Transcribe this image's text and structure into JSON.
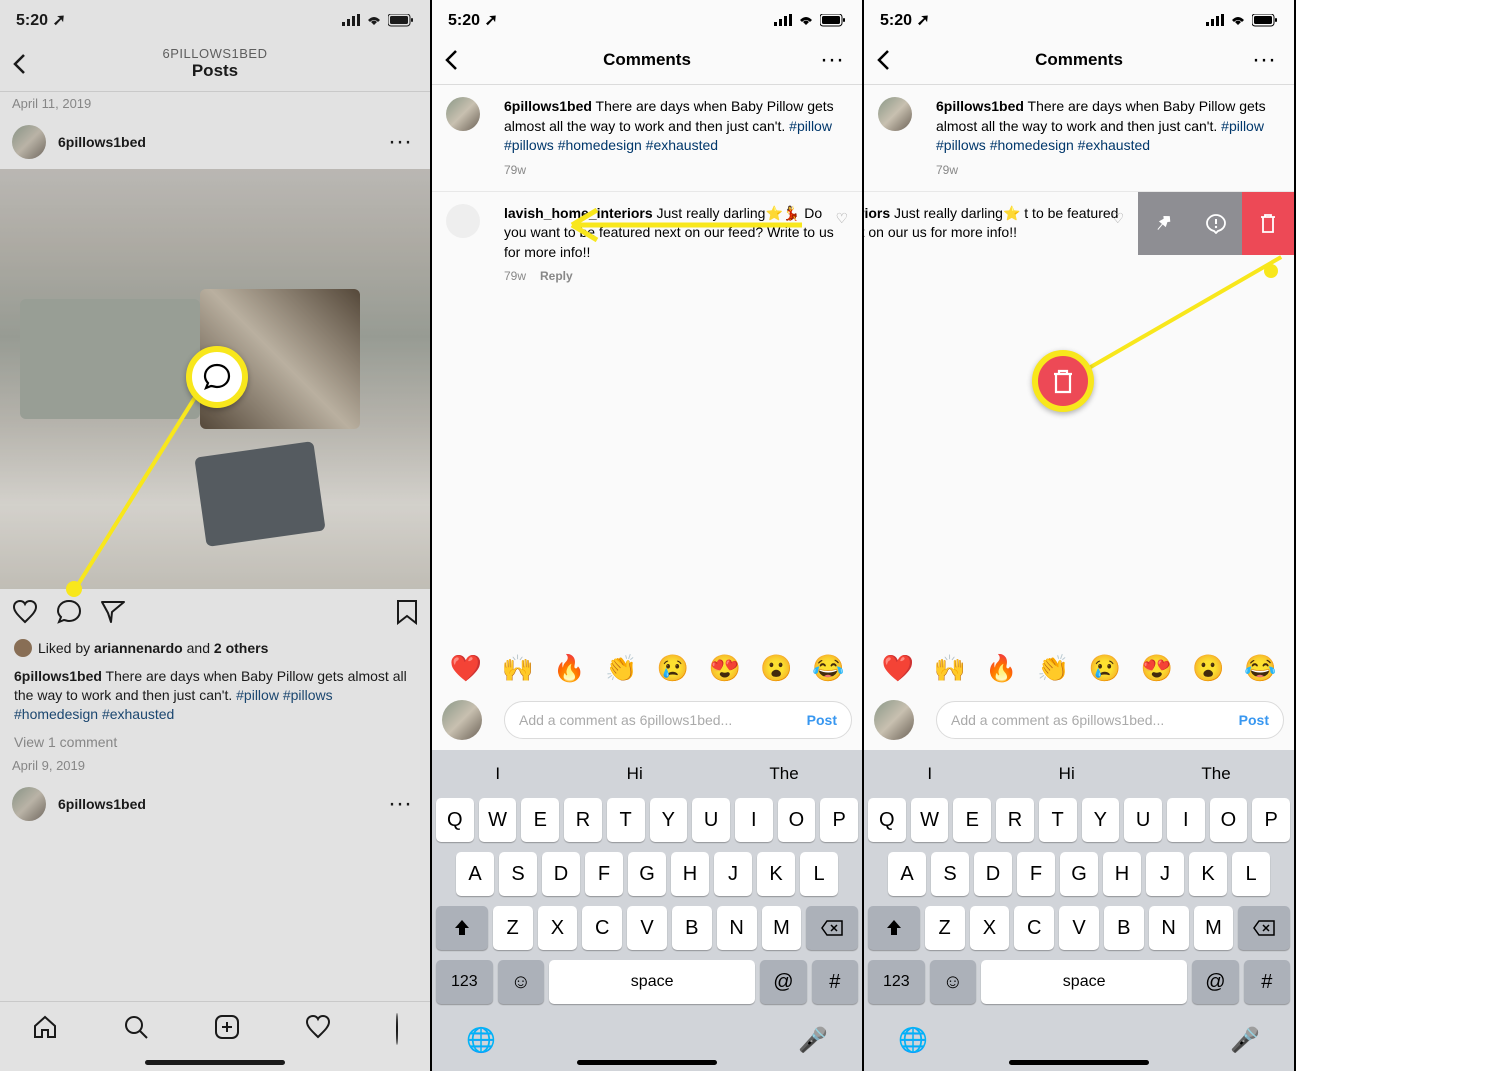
{
  "status": {
    "time": "5:20",
    "arrow": "➚"
  },
  "screen1": {
    "header_sub": "6PILLOWS1BED",
    "header_title": "Posts",
    "date_top": "April 11, 2019",
    "username": "6pillows1bed",
    "likes_prefix": "Liked by ",
    "likes_user": "ariannenardo",
    "likes_mid": " and ",
    "likes_others": "2 others",
    "caption_user": "6pillows1bed",
    "caption_text": " There are days when Baby Pillow gets almost all the way to work and then just can't. ",
    "hashtags": "#pillow #pillows #homedesign #exhausted",
    "view_comments": "View 1 comment",
    "date_bottom": "April 9, 2019"
  },
  "comments_header": "Comments",
  "comments": {
    "author": "6pillows1bed",
    "caption": " There are days when Baby Pillow gets almost all the way to work and then just can't. ",
    "hashtags_1": "#pillow",
    "hashtags_2": "#pillows",
    "hashtags_3": "#homedesign",
    "hashtags_4": "#exhausted",
    "age": "79w",
    "comment1_user": "lavish_home_interiors",
    "comment1_text": " Just really darling⭐💃 Do you want to be featured next on our feed? Write to us for more info!!",
    "comment1_age": "79w",
    "reply": "Reply"
  },
  "emojis": [
    "❤️",
    "🙌",
    "🔥",
    "👏",
    "😢",
    "😍",
    "😮",
    "😂"
  ],
  "input_placeholder": "Add a comment as 6pillows1bed...",
  "post_btn": "Post",
  "suggestions": [
    "I",
    "Hi",
    "The"
  ],
  "keyboard": {
    "r1": [
      "Q",
      "W",
      "E",
      "R",
      "T",
      "Y",
      "U",
      "I",
      "O",
      "P"
    ],
    "r2": [
      "A",
      "S",
      "D",
      "F",
      "G",
      "H",
      "J",
      "K",
      "L"
    ],
    "r3": [
      "Z",
      "X",
      "C",
      "V",
      "B",
      "N",
      "M"
    ],
    "num": "123",
    "space": "space",
    "at": "@",
    "hash": "#"
  },
  "screen3": {
    "comment_visible": "nteriors",
    "comment_text": " Just really darling⭐ t to be featured next on our us for more info!!"
  }
}
